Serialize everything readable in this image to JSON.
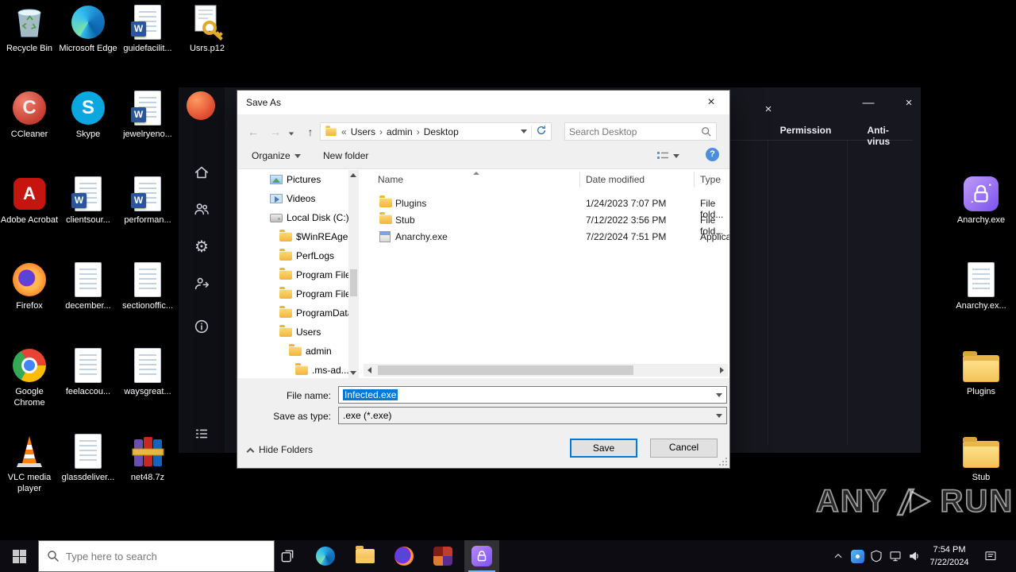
{
  "desktop": {
    "icons": [
      {
        "label": "Recycle Bin",
        "icon": "recycle-bin-icon"
      },
      {
        "label": "CCleaner",
        "icon": "ccleaner-icon"
      },
      {
        "label": "Adobe Acrobat",
        "icon": "acrobat-icon"
      },
      {
        "label": "Firefox",
        "icon": "firefox-icon"
      },
      {
        "label": "Google Chrome",
        "icon": "chrome-icon"
      },
      {
        "label": "VLC media player",
        "icon": "vlc-cone-icon"
      },
      {
        "label": "Microsoft Edge",
        "icon": "edge-icon"
      },
      {
        "label": "Skype",
        "icon": "skype-icon"
      },
      {
        "label": "clientsour...",
        "icon": "word-doc-icon"
      },
      {
        "label": "december...",
        "icon": "doc-icon"
      },
      {
        "label": "feelaccou...",
        "icon": "doc-icon"
      },
      {
        "label": "glassdeliver...",
        "icon": "doc-icon"
      },
      {
        "label": "guidefacilit...",
        "icon": "word-doc-icon"
      },
      {
        "label": "jewelryeno...",
        "icon": "word-doc-icon"
      },
      {
        "label": "performan...",
        "icon": "word-doc-icon"
      },
      {
        "label": "sectionoffic...",
        "icon": "doc-icon"
      },
      {
        "label": "waysgreat...",
        "icon": "doc-icon"
      },
      {
        "label": "net48.7z",
        "icon": "winrar-books-icon"
      },
      {
        "label": "Usrs.p12",
        "icon": "certificate-key-icon"
      },
      {
        "label": "Anarchy.exe",
        "icon": "anarchy-lock-icon"
      },
      {
        "label": "Anarchy.ex...",
        "icon": "doc-icon"
      },
      {
        "label": "Plugins",
        "icon": "folder-icon"
      },
      {
        "label": "Stub",
        "icon": "folder-icon"
      }
    ]
  },
  "builder_window": {
    "tabs": [
      {
        "label": "Permission"
      },
      {
        "label": "Anti-virus"
      }
    ]
  },
  "save_dialog": {
    "title": "Save As",
    "breadcrumb": {
      "prefix": "«",
      "items": [
        "Users",
        "admin",
        "Desktop"
      ]
    },
    "search": {
      "placeholder": "Search Desktop"
    },
    "toolbar": {
      "organize": "Organize",
      "new_folder": "New folder"
    },
    "tree": [
      {
        "label": "Pictures",
        "icon": "pictures-icon"
      },
      {
        "label": "Videos",
        "icon": "videos-icon"
      },
      {
        "label": "Local Disk (C:)",
        "icon": "drive-icon"
      },
      {
        "label": "$WinREAgent",
        "icon": "folder-icon"
      },
      {
        "label": "PerfLogs",
        "icon": "folder-icon"
      },
      {
        "label": "Program Files",
        "icon": "folder-icon"
      },
      {
        "label": "Program Files",
        "icon": "folder-icon"
      },
      {
        "label": "ProgramData",
        "icon": "folder-icon"
      },
      {
        "label": "Users",
        "icon": "folder-icon"
      },
      {
        "label": "admin",
        "icon": "folder-icon"
      },
      {
        "label": ".ms-ad...",
        "icon": "folder-icon"
      }
    ],
    "columns": {
      "name": "Name",
      "date_modified": "Date modified",
      "type": "Type"
    },
    "files": [
      {
        "name": "Plugins",
        "date_modified": "1/24/2023 7:07 PM",
        "type": "File fold...",
        "icon": "folder-icon"
      },
      {
        "name": "Stub",
        "date_modified": "7/12/2022 3:56 PM",
        "type": "File fold...",
        "icon": "folder-icon"
      },
      {
        "name": "Anarchy.exe",
        "date_modified": "7/22/2024 7:51 PM",
        "type": "Applicat...",
        "icon": "exe-icon"
      }
    ],
    "file_name": {
      "label": "File name:",
      "value": "Infected.exe"
    },
    "save_type": {
      "label": "Save as type:",
      "value": ".exe (*.exe)"
    },
    "hide_folders": "Hide Folders",
    "buttons": {
      "save": "Save",
      "cancel": "Cancel"
    }
  },
  "watermark": {
    "any": "ANY",
    "run": "RUN"
  },
  "taskbar": {
    "search": {
      "placeholder": "Type here to search"
    },
    "clock": {
      "time": "7:54 PM",
      "date": "7/22/2024"
    }
  }
}
